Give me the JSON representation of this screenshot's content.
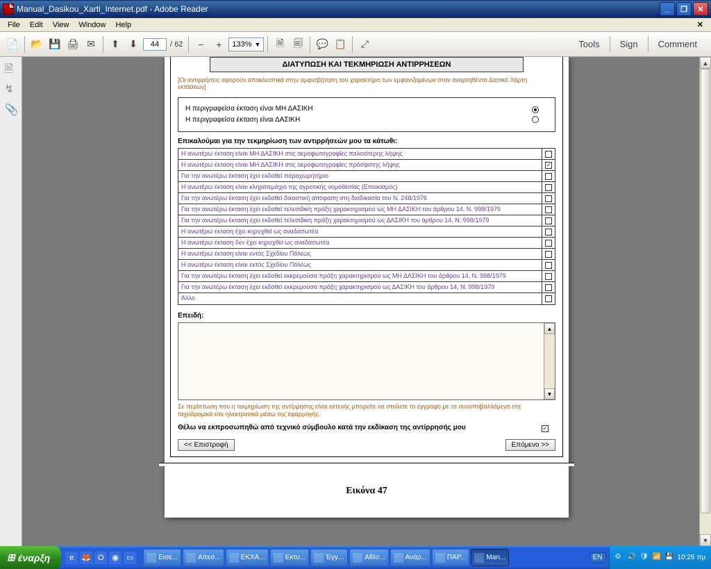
{
  "window": {
    "title": "Manual_Dasikou_Xarti_Internet.pdf - Adobe Reader",
    "min": "_",
    "max": "❐",
    "close": "✕"
  },
  "menu": {
    "file": "File",
    "edit": "Edit",
    "view": "View",
    "window": "Window",
    "help": "Help",
    "x": "✕"
  },
  "toolbar": {
    "page_current": "44",
    "page_total": "/  62",
    "zoom": "133%"
  },
  "rightmenu": {
    "tools": "Tools",
    "sign": "Sign",
    "comment": "Comment"
  },
  "form": {
    "section_title": "ΔΙΑΤΥΠΩΣΗ ΚΑΙ ΤΕΚΜΗΡΙΩΣΗ ΑΝΤΙΡΡΗΣΕΩΝ",
    "hint": "[Οι αντιρρήσεις αφορούν αποκλειστικά στην αμφισβήτηση του χαρακτήρα των εμφανιζομένων στον αναρτηθέντα Δασικό Χάρτη εκτάσεων]",
    "radio1": "Η περιγραφείσα έκταση είναι ΜΗ ΔΑΣΙΚΗ",
    "radio2": "Η περιγραφείσα έκταση είναι ΔΑΣΙΚΗ",
    "subhead": "Επικαλούμαι για την τεκμηρίωση των αντιρρήσεών μου τα κάτωθι:",
    "checks": [
      {
        "label": "Η ανωτέρω έκταση είναι ΜΗ ΔΑΣΙΚΗ στις αεροφωτογραφίες παλαιότερης λήψης",
        "checked": false
      },
      {
        "label": "Η ανωτέρω έκταση είναι ΜΗ ΔΑΣΙΚΗ στις αεροφωτογραφίες πρόσφατης λήψης",
        "checked": true
      },
      {
        "label": "Για την ανωτέρω έκταση έχει εκδοθεί παραχωρητήριο",
        "checked": false
      },
      {
        "label": "Η ανωτέρω έκταση είναι κληροτεμάχιο της αγροτικής νομοθεσίας (Εποικισμός)",
        "checked": false
      },
      {
        "label": "Για την ανωτέρω έκταση έχει εκδοθεί δικαστική απόφαση στη διαδικασία του Ν. 248/1976",
        "checked": false
      },
      {
        "label": "Για την ανωτέρω έκταση έχει εκδοθεί τελεσίδικη πράξη χαρακτηρισμού ως ΜΗ ΔΑΣΙΚΗ του άρθρου 14, Ν. 998/1979",
        "checked": false
      },
      {
        "label": "Για την ανωτέρω έκταση έχει εκδοθεί τελεσίδικη πράξη χαρακτηρισμού ως ΔΑΣΙΚΗ του άρθρου 14, Ν. 998/1979",
        "checked": false
      },
      {
        "label": "Η ανωτέρω έκταση έχει κηρυχθεί ως αναδασωτέα",
        "checked": false
      },
      {
        "label": "Η ανωτέρω έκταση δεν έχει κηρυχθεί ως αναδασωτέα",
        "checked": false
      },
      {
        "label": "Η ανωτέρω έκταση είναι εντός Σχεδίου Πόλεως",
        "checked": false
      },
      {
        "label": "Η ανωτέρω έκταση είναι εκτός Σχεδίου Πόλεως",
        "checked": false
      },
      {
        "label": "Για την ανωτέρω έκταση έχει εκδοθεί εκκρεμούσα πράξη χαρακτηρισμού ως ΜΗ ΔΑΣΙΚΗ του άρθρου 14, Ν. 998/1979",
        "checked": false
      },
      {
        "label": "Για την ανωτέρω έκταση έχει εκδοθεί εκκρεμούσα πράξη χαρακτηρισμού ως ΔΑΣΙΚΗ του άρθρου 14, Ν. 998/1979",
        "checked": false
      },
      {
        "label": "Άλλο",
        "checked": false
      }
    ],
    "because": "Επειδή:",
    "note": "Σε περίπτωση που η τεκμηρίωση της αντίρρησης είναι εκτενής μπορείτε να στείλετε το έγγραφο με τα συνυποβαλλόμενα είτε ταχυδρομικά είτε ηλεκτρονικά μέσω της εφαρμογής.",
    "represent": "Θέλω να εκπροσωπηθώ από τεχνικό σύμβουλο κατά την εκδίκαση της αντίρρησής μου",
    "back": "<< Επιστροφή",
    "next": "Επόμενο >>",
    "caption": "Εικόνα 47"
  },
  "taskbar": {
    "start": "έναρξη",
    "tasks": [
      {
        "label": "Εισε...",
        "active": false
      },
      {
        "label": "Απεσ...",
        "active": false
      },
      {
        "label": "ΕΚΧΑ...",
        "active": false
      },
      {
        "label": "Εκτυ...",
        "active": false
      },
      {
        "label": "Έγγ...",
        "active": false
      },
      {
        "label": "Allilo...",
        "active": false
      },
      {
        "label": "Ανάρ...",
        "active": false
      },
      {
        "label": "ΠΑΡ...",
        "active": false
      },
      {
        "label": "Man...",
        "active": true
      }
    ],
    "lang": "EN",
    "clock": "10:26 πμ"
  }
}
